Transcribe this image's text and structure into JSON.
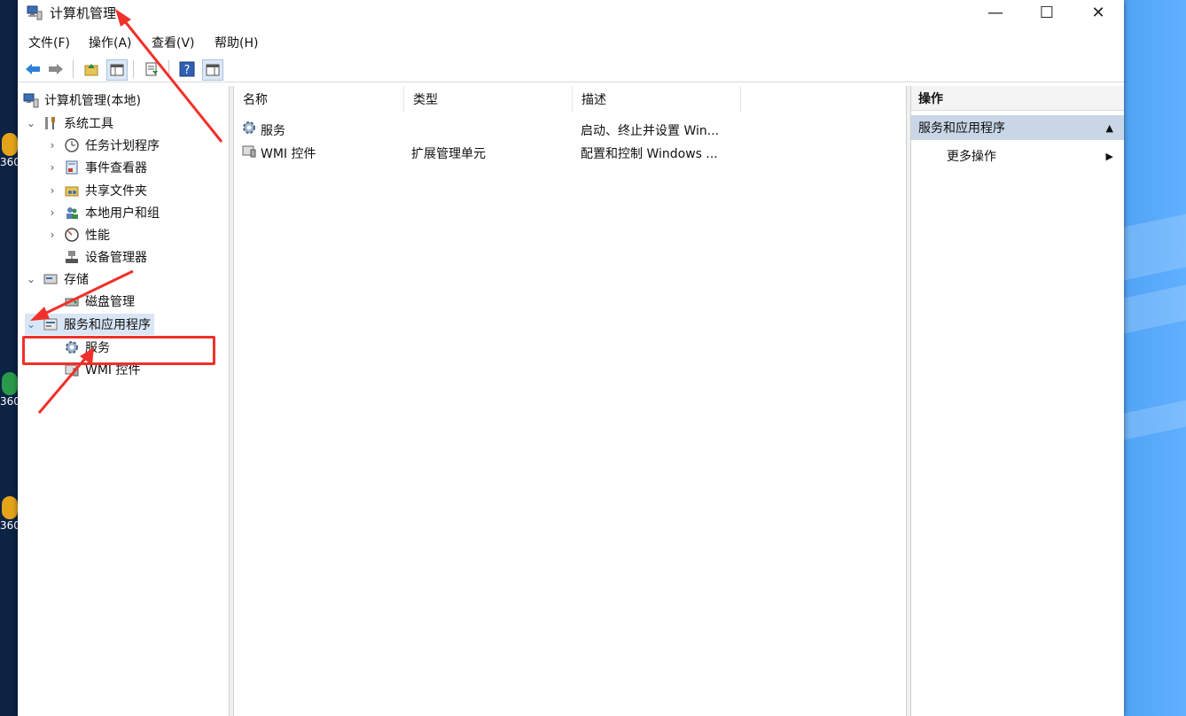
{
  "window": {
    "title": "计算机管理",
    "minimize_glyph": "—",
    "maximize_glyph": "☐",
    "close_glyph": "✕"
  },
  "menu": [
    {
      "label": "文件(F)"
    },
    {
      "label": "操作(A)"
    },
    {
      "label": "查看(V)"
    },
    {
      "label": "帮助(H)"
    }
  ],
  "toolbar": {
    "icons": [
      "back-arrow-icon",
      "forward-arrow-icon",
      "up-folder-icon",
      "show-hide-tree-icon",
      "export-list-icon",
      "help-icon",
      "show-hide-action-pane-icon"
    ]
  },
  "tree": {
    "root": "计算机管理(本地)",
    "system_tools": "系统工具",
    "system_tools_children": [
      "任务计划程序",
      "事件查看器",
      "共享文件夹",
      "本地用户和组",
      "性能",
      "设备管理器"
    ],
    "storage": "存储",
    "storage_children": [
      "磁盘管理"
    ],
    "services_apps": "服务和应用程序",
    "services_apps_children": [
      "服务",
      "WMI 控件"
    ],
    "expanded_glyph": "⌄",
    "collapsed_glyph": "›"
  },
  "list": {
    "columns": [
      "名称",
      "类型",
      "描述"
    ],
    "rows": [
      {
        "name": "服务",
        "type": "",
        "desc": "启动、终止并设置 Win..."
      },
      {
        "name": "WMI 控件",
        "type": "扩展管理单元",
        "desc": "配置和控制 Windows ..."
      }
    ]
  },
  "actions": {
    "header": "操作",
    "section": "服务和应用程序",
    "section_glyph": "▲",
    "item": "更多操作",
    "item_glyph": "▶"
  },
  "desktop": {
    "icon_labels": [
      "360",
      "360",
      "360"
    ]
  },
  "colors": {
    "highlight_box": "#f0302a",
    "selection": "#d9e6f5",
    "action_section": "#c8d6e6"
  }
}
